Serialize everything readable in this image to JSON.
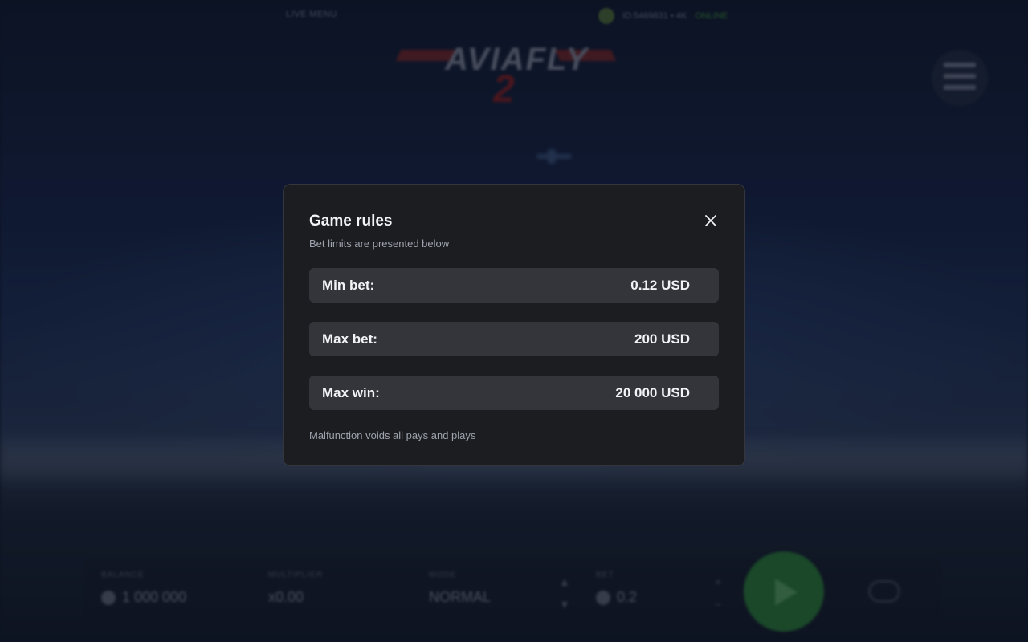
{
  "background": {
    "game_label": "LIVE MENU",
    "user_name": "ID:5469831 • 4K",
    "online_status": "ONLINE",
    "logo_text": "AVIAFLY",
    "logo_number": "2",
    "bottom_bar": {
      "balance_label": "BALANCE",
      "balance_value": "1 000 000",
      "multiplier_label": "MULTIPLIER",
      "multiplier_value": "x0.00",
      "mode_label": "MODE",
      "mode_value": "NORMAL",
      "bet_label": "BET",
      "bet_value": "0.2"
    }
  },
  "modal": {
    "title": "Game rules",
    "subtitle": "Bet limits are presented below",
    "rows": [
      {
        "label": "Min bet:",
        "value": "0.12 USD"
      },
      {
        "label": "Max bet:",
        "value": "200 USD"
      },
      {
        "label": "Max win:",
        "value": "20 000 USD"
      }
    ],
    "footer": "Malfunction voids all pays and plays",
    "close_icon": "close-icon"
  },
  "colors": {
    "modal_bg": "#1c1d21",
    "row_bg": "#34353b",
    "text_primary": "#f2f3f5",
    "text_secondary": "#9ea3ad",
    "play_green": "#2a7a3a"
  }
}
